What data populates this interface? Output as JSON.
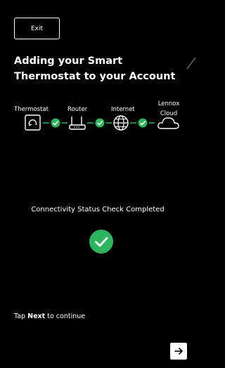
{
  "header": {
    "exit_label": "Exit"
  },
  "title": "Adding your Smart Thermostat to your Account",
  "steps": [
    {
      "label": "Thermostat",
      "icon": "thermostat-icon"
    },
    {
      "label": "Router",
      "icon": "router-icon"
    },
    {
      "label": "Internet",
      "icon": "globe-icon"
    },
    {
      "label": "Lennox Cloud",
      "icon": "cloud-icon"
    }
  ],
  "connections": [
    "ok",
    "ok",
    "ok"
  ],
  "status": {
    "message": "Connectivity Status Check Completed",
    "icon": "check-circle-icon",
    "color": "#2db55d"
  },
  "footer": {
    "tap_prefix": "Tap",
    "tap_emphasis": "Next",
    "tap_suffix": "to continue",
    "next_icon": "arrow-right-icon"
  },
  "colors": {
    "background": "#000000",
    "text": "#ffffff",
    "success": "#2db55d"
  }
}
